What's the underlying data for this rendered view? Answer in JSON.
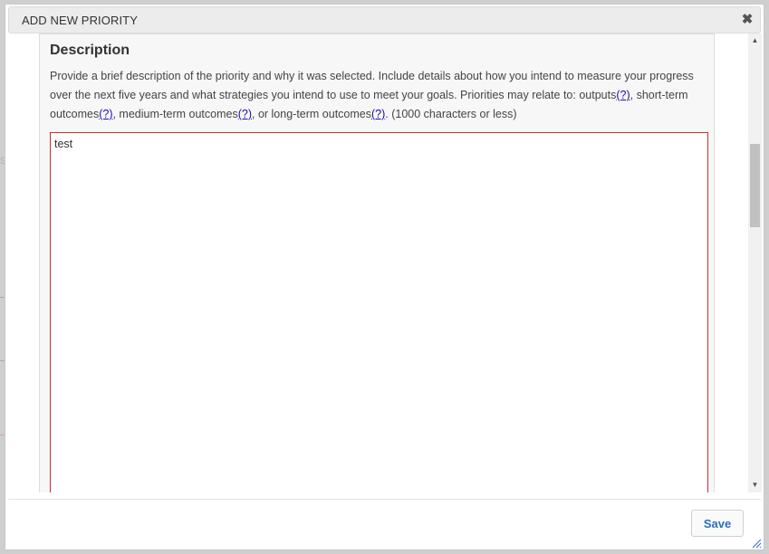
{
  "modal": {
    "title": "ADD NEW PRIORITY",
    "close_icon": "close-icon",
    "close_glyph": "✖"
  },
  "description": {
    "heading": "Description",
    "help_segments": {
      "intro": "Provide a brief description of the priority and why it was selected. Include details about how you intend to measure your progress over the next five years and what strategies you intend to use to meet your goals. Priorities may relate to: outputs",
      "link": "(?)",
      "after_outputs": ", short-term outcomes",
      "after_short": ", medium-term outcomes",
      "after_medium": ", or long-term outcomes",
      "after_long": ". (1000 characters or less)"
    },
    "textarea_value": "test",
    "textarea_border_color": "#c9302c"
  },
  "scrollbar": {
    "up_glyph": "▲",
    "down_glyph": "▼"
  },
  "footer": {
    "save_label": "Save",
    "save_color": "#2a6fc0"
  }
}
